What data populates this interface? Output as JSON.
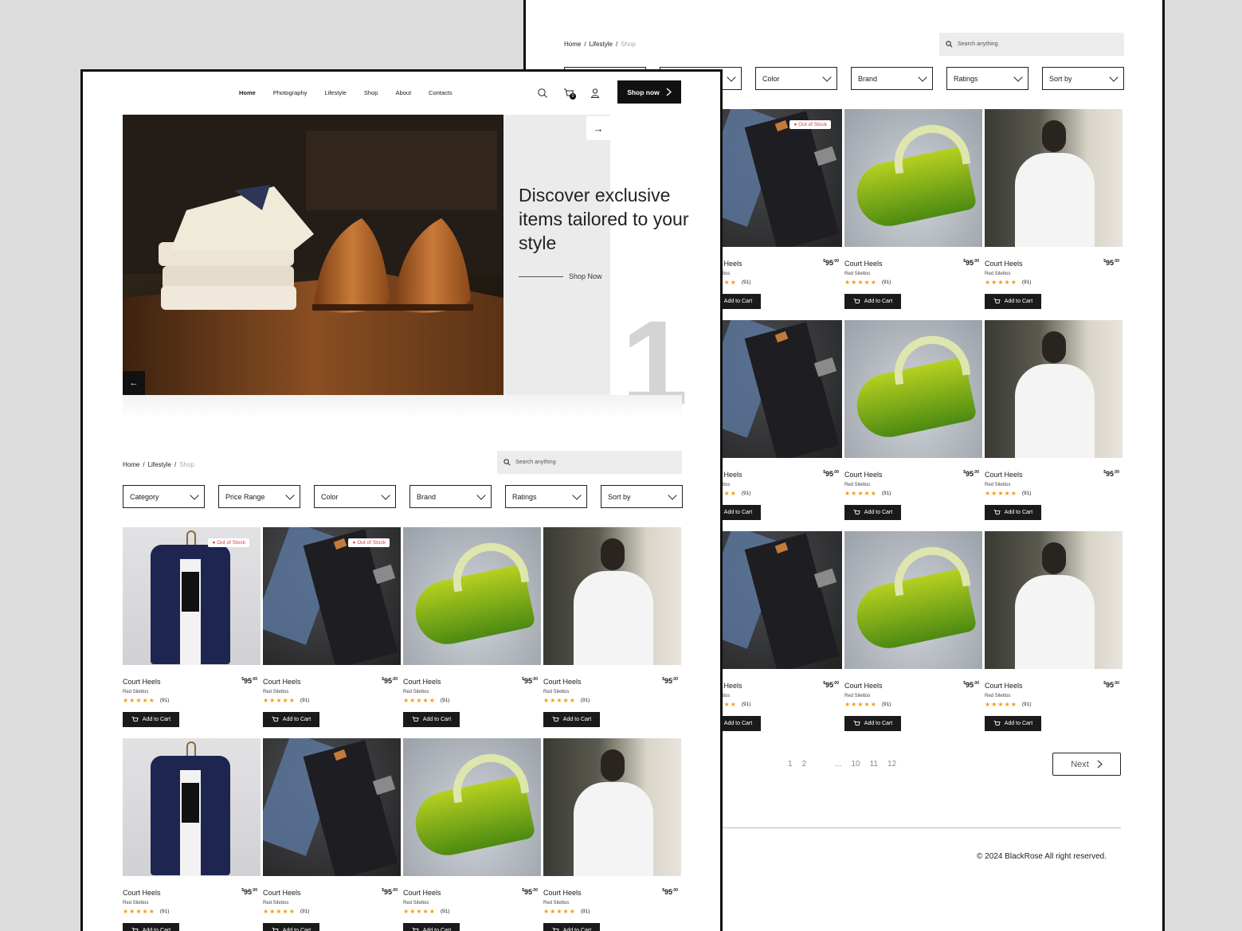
{
  "nav": {
    "items": [
      "Home",
      "Photography",
      "Lifestyle",
      "Shop",
      "About",
      "Contacts"
    ],
    "active": "Home",
    "cart_count": "0",
    "shop_now_label": "Shop now"
  },
  "hero": {
    "title": "Discover exclusive items tailored to your style",
    "cta": "Shop Now",
    "slide_number": "1"
  },
  "breadcrumb": {
    "home": "Home",
    "lifestyle": "Lifestyle",
    "current": "Shop",
    "sep": "/"
  },
  "search": {
    "placeholder": "Search anything"
  },
  "filters": [
    "Category",
    "Price Range",
    "Color",
    "Brand",
    "Ratings",
    "Sort by"
  ],
  "product": {
    "name": "Court Heels",
    "subtitle": "Red Silettos",
    "price_currency": "$",
    "price_main": "95",
    "price_cents": ".00",
    "stars": "★★★★★",
    "review_count": "(91)",
    "add_to_cart": "Add to Cart",
    "out_of_stock": "Out of Stock"
  },
  "pagination": {
    "pages": [
      "1",
      "2",
      "...",
      "10",
      "11",
      "12"
    ],
    "next": "Next"
  },
  "footer": {
    "copyright": "© 2024 BlackRose All right reserved."
  },
  "colors": {
    "accent": "#111111",
    "star": "#f39c12",
    "badge": "#e03a3a",
    "panel": "#ebebeb"
  }
}
